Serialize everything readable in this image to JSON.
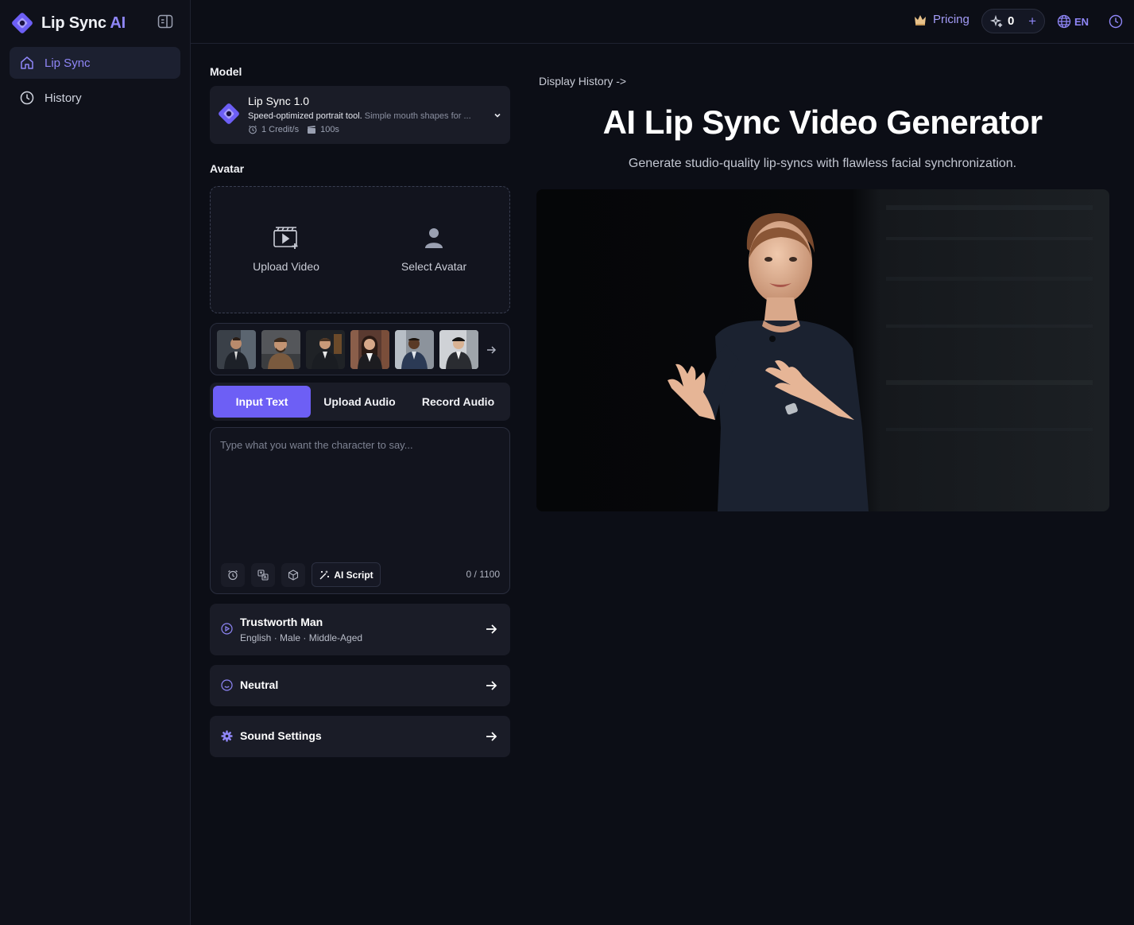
{
  "brand": {
    "name_main": "Lip Sync",
    "name_accent": "AI"
  },
  "sidebar": {
    "items": [
      {
        "label": "Lip Sync",
        "icon": "home-icon",
        "active": true
      },
      {
        "label": "History",
        "icon": "clock-icon",
        "active": false
      }
    ]
  },
  "topbar": {
    "pricing_label": "Pricing",
    "credits": "0",
    "credits_add": "+",
    "language": "EN"
  },
  "form": {
    "model_label": "Model",
    "model": {
      "title": "Lip Sync 1.0",
      "desc_main": "Speed-optimized portrait tool.",
      "desc_muted": " Simple mouth shapes for ...",
      "rate": "1 Credit/s",
      "duration": "100s"
    },
    "avatar_label": "Avatar",
    "upload_video": "Upload Video",
    "select_avatar": "Select Avatar",
    "tabs": [
      "Input Text",
      "Upload Audio",
      "Record Audio"
    ],
    "text_placeholder": "Type what you want the character to say...",
    "ai_script": "AI Script",
    "char_count": "0 / 1100",
    "voice": {
      "title": "Trustworth Man",
      "subtitle": "English · Male · Middle-Aged"
    },
    "emotion": {
      "title": "Neutral"
    },
    "sound_settings": {
      "title": "Sound Settings"
    }
  },
  "main": {
    "display_history": "Display History ->",
    "title": "AI Lip Sync Video Generator",
    "subtitle": "Generate studio-quality lip-syncs with flawless facial synchronization."
  },
  "colors": {
    "accent": "#6d5ff5",
    "accent_text": "#8f86f7",
    "bg": "#0c0e16",
    "panel": "#1a1c27"
  }
}
